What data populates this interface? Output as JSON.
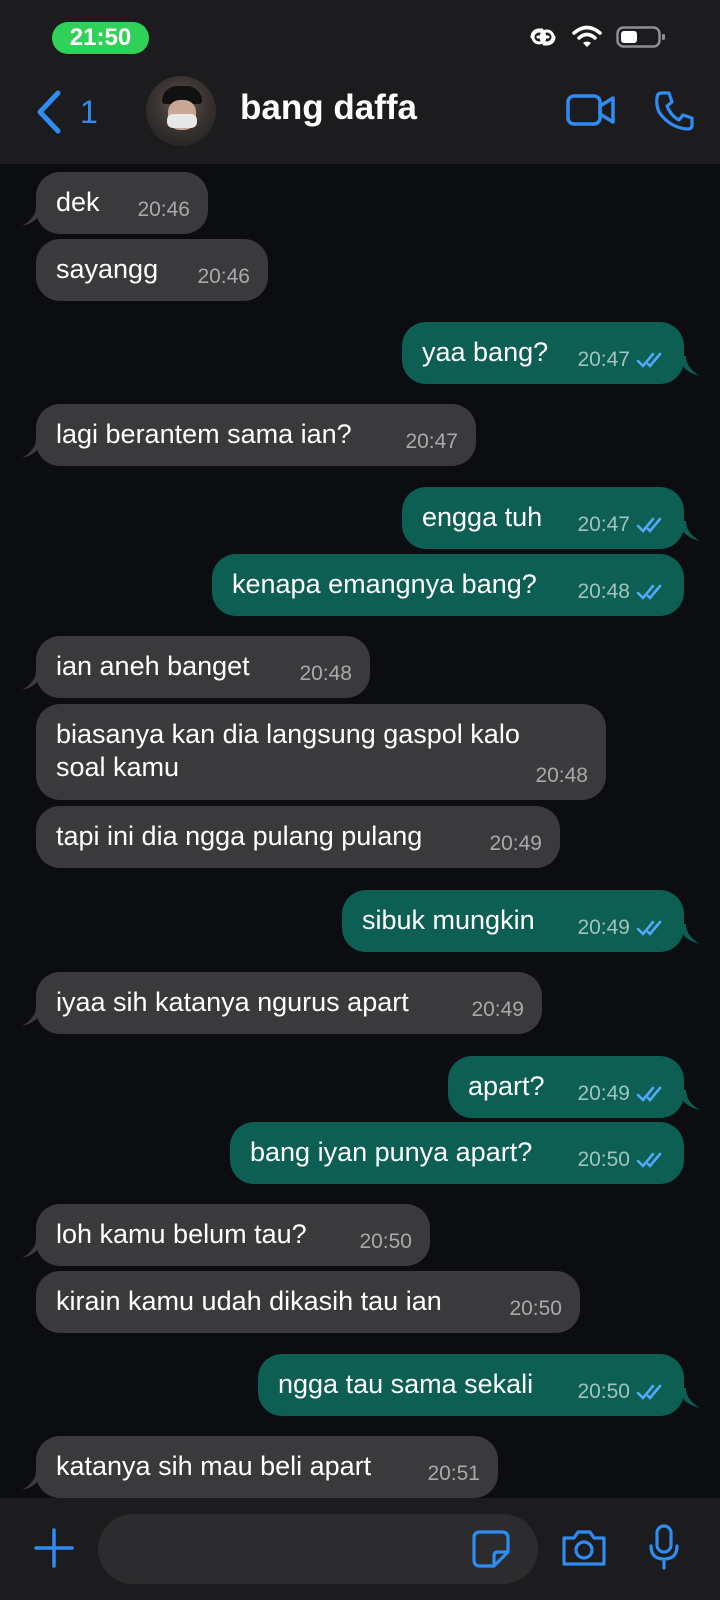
{
  "status_bar": {
    "time": "21:50"
  },
  "header": {
    "unread_count": "1",
    "contact_name": "bang daffa",
    "icons": {
      "back": "chevron-left-icon",
      "video": "video-camera-icon",
      "call": "phone-icon"
    }
  },
  "colors": {
    "accent": "#2f8cf0",
    "incoming": "#3a3a3c",
    "outgoing": "#0d5f54",
    "read_ticks": "#53a9f7"
  },
  "messages": [
    {
      "direction": "in",
      "text": "dek",
      "time": "20:46"
    },
    {
      "direction": "in",
      "text": "sayangg",
      "time": "20:46"
    },
    {
      "direction": "out",
      "text": "yaa bang?",
      "time": "20:47"
    },
    {
      "direction": "in",
      "text": "lagi berantem sama ian?",
      "time": "20:47"
    },
    {
      "direction": "out",
      "text": "engga tuh",
      "time": "20:47"
    },
    {
      "direction": "out",
      "text": "kenapa emangnya bang?",
      "time": "20:48"
    },
    {
      "direction": "in",
      "text": "ian aneh banget",
      "time": "20:48"
    },
    {
      "direction": "in",
      "text": "biasanya kan dia langsung gaspol kalo soal kamu",
      "time": "20:48"
    },
    {
      "direction": "in",
      "text": "tapi ini dia ngga pulang pulang",
      "time": "20:49"
    },
    {
      "direction": "out",
      "text": "sibuk mungkin",
      "time": "20:49"
    },
    {
      "direction": "in",
      "text": "iyaa sih katanya ngurus apart",
      "time": "20:49"
    },
    {
      "direction": "out",
      "text": "apart?",
      "time": "20:49"
    },
    {
      "direction": "out",
      "text": "bang iyan punya apart?",
      "time": "20:50"
    },
    {
      "direction": "in",
      "text": "loh kamu belum tau?",
      "time": "20:50"
    },
    {
      "direction": "in",
      "text": "kirain kamu udah dikasih tau ian",
      "time": "20:50"
    },
    {
      "direction": "out",
      "text": "ngga tau sama sekali",
      "time": "20:50"
    },
    {
      "direction": "in",
      "text": "katanya sih mau beli apart",
      "time": "20:51"
    }
  ],
  "composer": {
    "placeholder": ""
  }
}
